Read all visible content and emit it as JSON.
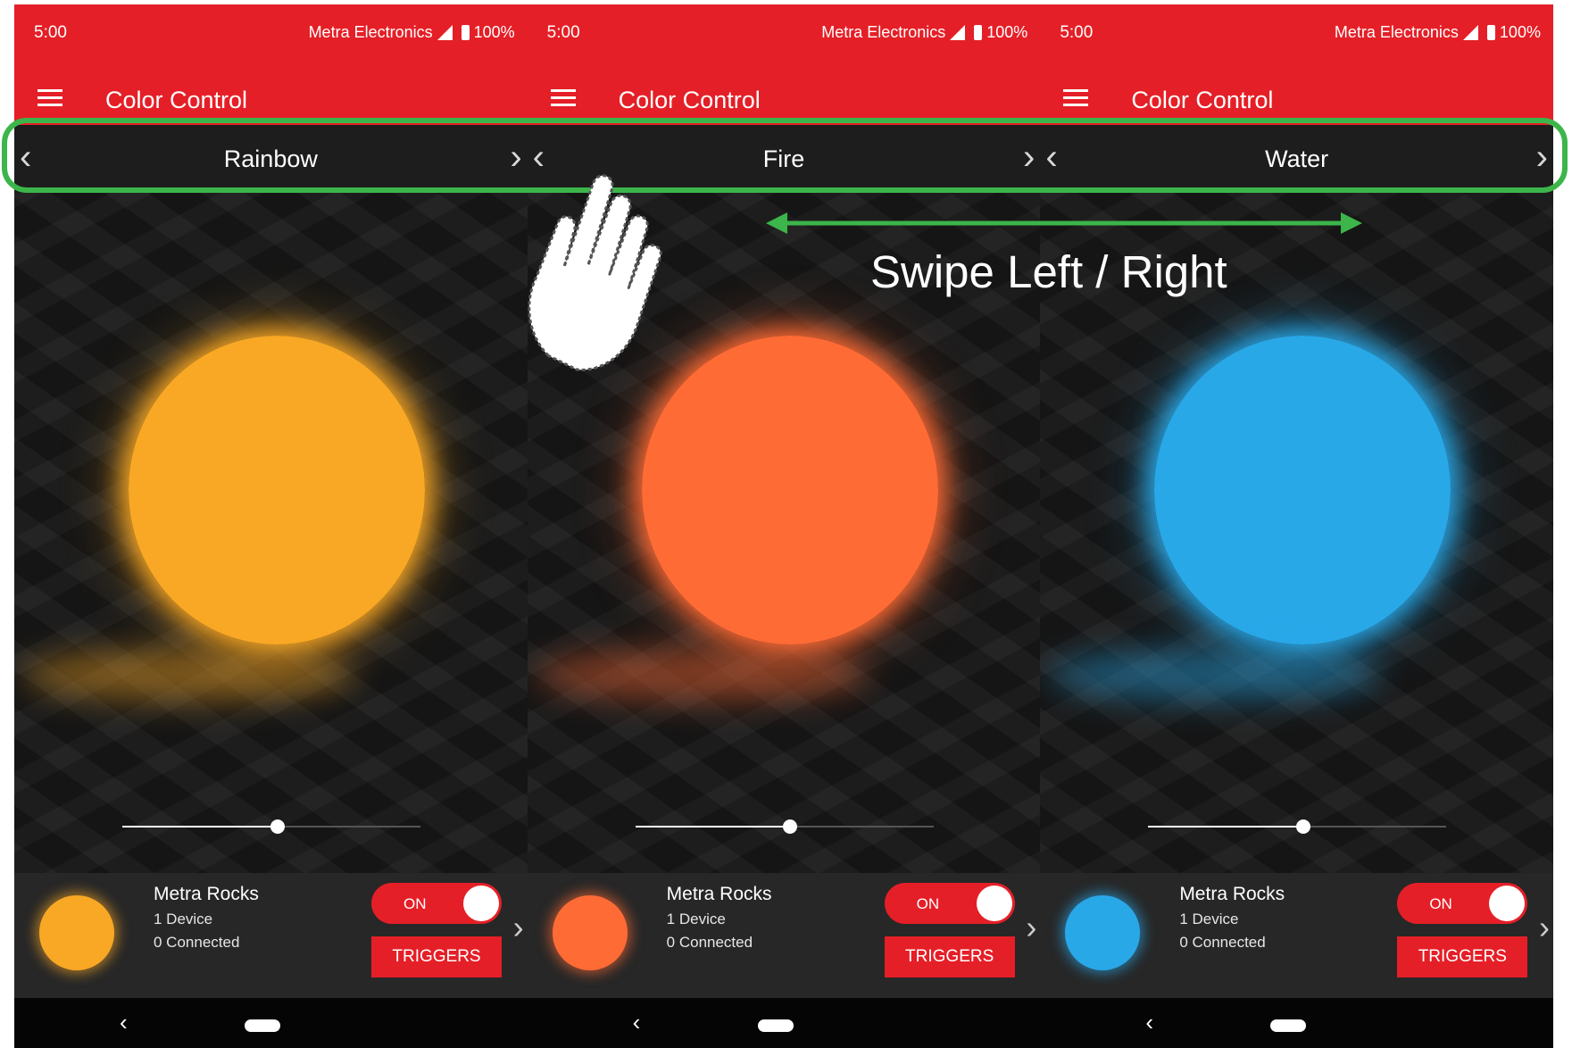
{
  "status_bar": {
    "time": "5:00",
    "carrier": "Metra Electronics",
    "battery": "100%"
  },
  "app_bar": {
    "title": "Color Control",
    "menu_icon": "hamburger-menu-icon"
  },
  "screens": [
    {
      "mode": "Rainbow",
      "orb_color": "#f9a825",
      "slider_value": 0.52,
      "device": {
        "name": "Metra Rocks",
        "devices": "1 Device",
        "connected": "0 Connected"
      },
      "toggle_label": "ON",
      "triggers_label": "TRIGGERS"
    },
    {
      "mode": "Fire",
      "orb_color": "#ff6b35",
      "slider_value": 0.52,
      "device": {
        "name": "Metra Rocks",
        "devices": "1 Device",
        "connected": "0 Connected"
      },
      "toggle_label": "ON",
      "triggers_label": "TRIGGERS"
    },
    {
      "mode": "Water",
      "orb_color": "#29a8e8",
      "slider_value": 0.52,
      "device": {
        "name": "Metra Rocks",
        "devices": "1 Device",
        "connected": "0 Connected"
      },
      "toggle_label": "ON",
      "triggers_label": "TRIGGERS"
    }
  ],
  "overlay": {
    "instruction": "Swipe Left / Right",
    "highlight_color": "#3cb54a",
    "icons": [
      "pointing-hand-icon",
      "double-arrow-icon"
    ]
  },
  "colors": {
    "accent_red": "#e51f27",
    "background": "#141414",
    "device_bar": "#272727"
  }
}
